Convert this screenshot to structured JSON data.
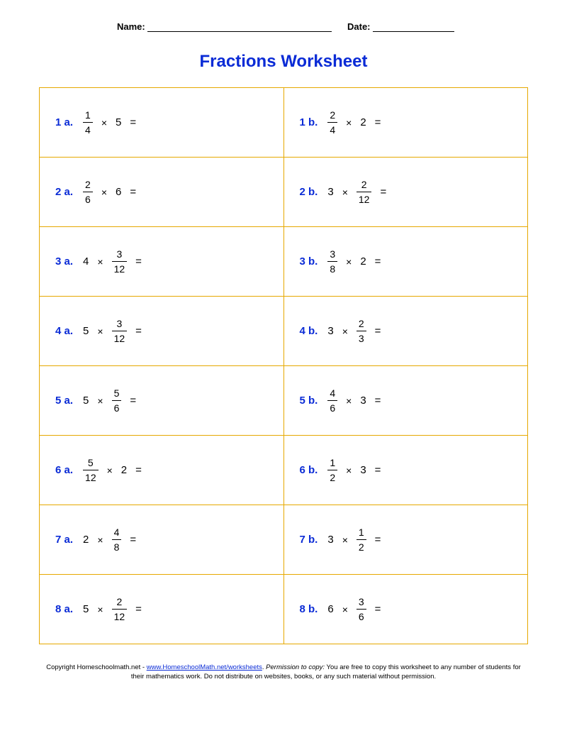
{
  "header": {
    "name_label": "Name:",
    "date_label": "Date:"
  },
  "title": "Fractions Worksheet",
  "problems": [
    [
      {
        "label": "1 a.",
        "type": "frac_first",
        "num": "1",
        "den": "4",
        "whole": "5"
      },
      {
        "label": "1 b.",
        "type": "frac_first",
        "num": "2",
        "den": "4",
        "whole": "2"
      }
    ],
    [
      {
        "label": "2 a.",
        "type": "frac_first",
        "num": "2",
        "den": "6",
        "whole": "6"
      },
      {
        "label": "2 b.",
        "type": "whole_first",
        "whole": "3",
        "num": "2",
        "den": "12"
      }
    ],
    [
      {
        "label": "3 a.",
        "type": "whole_first",
        "whole": "4",
        "num": "3",
        "den": "12"
      },
      {
        "label": "3 b.",
        "type": "frac_first",
        "num": "3",
        "den": "8",
        "whole": "2"
      }
    ],
    [
      {
        "label": "4 a.",
        "type": "whole_first",
        "whole": "5",
        "num": "3",
        "den": "12"
      },
      {
        "label": "4 b.",
        "type": "whole_first",
        "whole": "3",
        "num": "2",
        "den": "3"
      }
    ],
    [
      {
        "label": "5 a.",
        "type": "whole_first",
        "whole": "5",
        "num": "5",
        "den": "6"
      },
      {
        "label": "5 b.",
        "type": "frac_first",
        "num": "4",
        "den": "6",
        "whole": "3"
      }
    ],
    [
      {
        "label": "6 a.",
        "type": "frac_first",
        "num": "5",
        "den": "12",
        "whole": "2"
      },
      {
        "label": "6 b.",
        "type": "frac_first",
        "num": "1",
        "den": "2",
        "whole": "3"
      }
    ],
    [
      {
        "label": "7 a.",
        "type": "whole_first",
        "whole": "2",
        "num": "4",
        "den": "8"
      },
      {
        "label": "7 b.",
        "type": "whole_first",
        "whole": "3",
        "num": "1",
        "den": "2"
      }
    ],
    [
      {
        "label": "8 a.",
        "type": "whole_first",
        "whole": "5",
        "num": "2",
        "den": "12"
      },
      {
        "label": "8 b.",
        "type": "whole_first",
        "whole": "6",
        "num": "3",
        "den": "6"
      }
    ]
  ],
  "symbols": {
    "times": "×",
    "equals": "="
  },
  "footer": {
    "copyright_prefix": "Copyright Homeschoolmath.net - ",
    "link_text": "www.HomeschoolMath.net/worksheets",
    "period": ".  ",
    "permission_label": "Permission to copy:",
    "permission_text": " You are free to copy this worksheet to any number of students for their mathematics work. Do not distribute on websites, books, or any such material without permission."
  }
}
